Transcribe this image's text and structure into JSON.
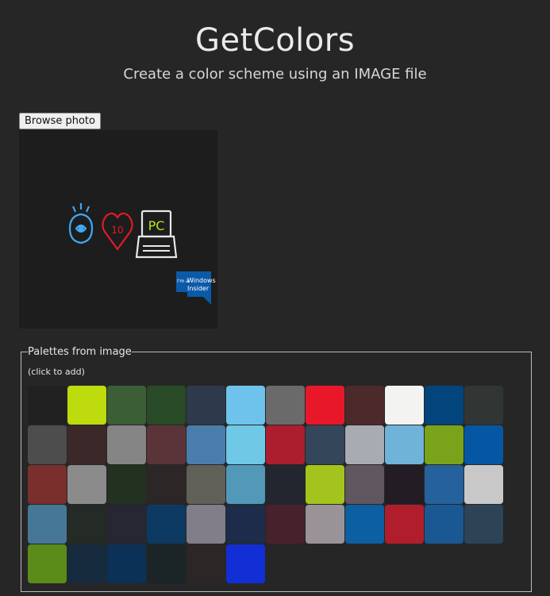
{
  "header": {
    "title": "GetColors",
    "subtitle": "Create a color scheme using an IMAGE file"
  },
  "upload": {
    "browse_label": "Browse photo"
  },
  "preview": {
    "badge_text_1": "Windows",
    "badge_text_2": "Insider",
    "badge_prefix": "I'm a",
    "pc_text": "PC",
    "heart_text": "10"
  },
  "palettes": {
    "legend": "Palettes from image",
    "hint": "(click to add)",
    "swatches": [
      "#212121",
      "#bddb0d",
      "#3b5e37",
      "#284a26",
      "#2e3a4b",
      "#6ec3ec",
      "#6a6a6a",
      "#e8182a",
      "#4c2a2c",
      "#f3f3f1",
      "#02457d",
      "#313634",
      "#4d4d4d",
      "#3b2929",
      "#858585",
      "#5b3439",
      "#4a7dab",
      "#6ec8e6",
      "#ac1e2e",
      "#34465a",
      "#a8abb1",
      "#70b3d9",
      "#7aa31b",
      "#0557a3",
      "#7a2f2c",
      "#8b8b8b",
      "#223120",
      "#2c2626",
      "#606058",
      "#5198b9",
      "#24262f",
      "#a3c41d",
      "#5f565f",
      "#241c24",
      "#25619c",
      "#c8c8c8",
      "#467796",
      "#242a26",
      "#272733",
      "#0c3a63",
      "#817e89",
      "#1d2c4b",
      "#47222c",
      "#999398",
      "#0c5fa0",
      "#b01e2b",
      "#1a5893",
      "#2d4457",
      "#5b8c19",
      "#172b3e",
      "#0b3157",
      "#1b2427",
      "#2d2626",
      "#122fd6"
    ]
  }
}
